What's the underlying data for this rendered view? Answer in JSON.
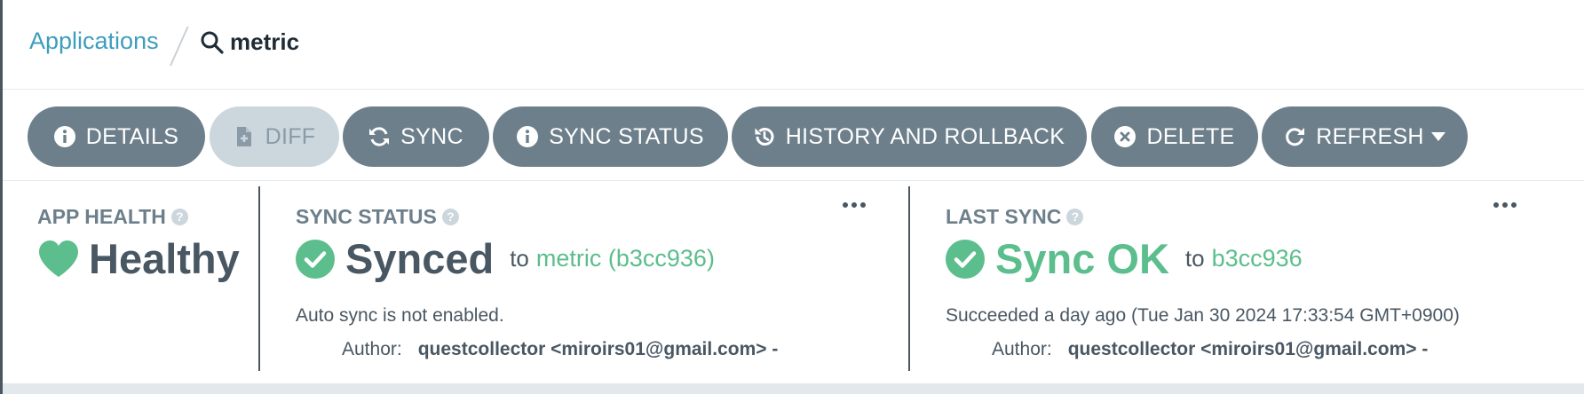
{
  "breadcrumb": {
    "root": "Applications",
    "current": "metric"
  },
  "toolbar": {
    "details": "DETAILS",
    "diff": "DIFF",
    "sync": "SYNC",
    "sync_status": "SYNC STATUS",
    "history": "HISTORY AND ROLLBACK",
    "delete": "DELETE",
    "refresh": "REFRESH"
  },
  "app_health": {
    "title": "APP HEALTH",
    "help": "?",
    "status": "Healthy"
  },
  "sync_status": {
    "title": "SYNC STATUS",
    "help": "?",
    "status": "Synced",
    "to": "to",
    "revision": "metric (b3cc936)",
    "auto_sync": "Auto sync is not enabled.",
    "author_label": "Author:",
    "author": "questcollector <miroirs01@gmail.com> -"
  },
  "last_sync": {
    "title": "LAST SYNC",
    "help": "?",
    "status": "Sync OK",
    "to": "to",
    "revision": "b3cc936",
    "succeeded": "Succeeded a day ago (Tue Jan 30 2024 17:33:54 GMT+0900)",
    "author_label": "Author:",
    "author": "questcollector <miroirs01@gmail.com> -"
  },
  "colors": {
    "accent_link": "#3e9dbd",
    "success": "#5bbe8c",
    "button": "#6d7f8b",
    "button_disabled": "#ccd6dd",
    "text": "#495763"
  }
}
